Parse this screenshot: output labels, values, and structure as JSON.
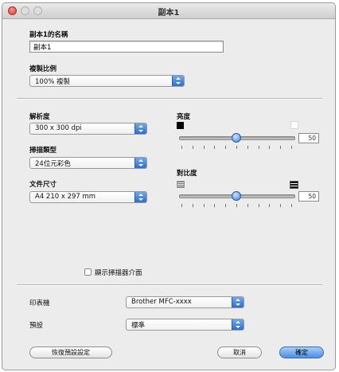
{
  "window": {
    "title": "副本1"
  },
  "name_section": {
    "label": "副本1的名稱",
    "value": "副本1"
  },
  "copy_ratio": {
    "label": "複製比例",
    "selected": "100% 複製"
  },
  "resolution": {
    "label": "解析度",
    "selected": "300 x 300 dpi"
  },
  "scan_type": {
    "label": "掃描類型",
    "selected": "24位元彩色"
  },
  "doc_size": {
    "label": "文件尺寸",
    "selected": "A4 210 x 297 mm"
  },
  "brightness": {
    "label": "亮度",
    "value": "50",
    "level_percent": 50
  },
  "contrast": {
    "label": "對比度",
    "value": "50",
    "level_percent": 50
  },
  "show_ui": {
    "label": "顯示掃描器介面",
    "checked": false
  },
  "printer": {
    "label": "印表機",
    "selected": "Brother MFC-xxxx"
  },
  "preset": {
    "label": "預設",
    "selected": "標準"
  },
  "buttons": {
    "restore": "恢復預設設定",
    "cancel": "取消",
    "ok": "確定"
  },
  "colors": {
    "accent": "#3b7dd8"
  }
}
